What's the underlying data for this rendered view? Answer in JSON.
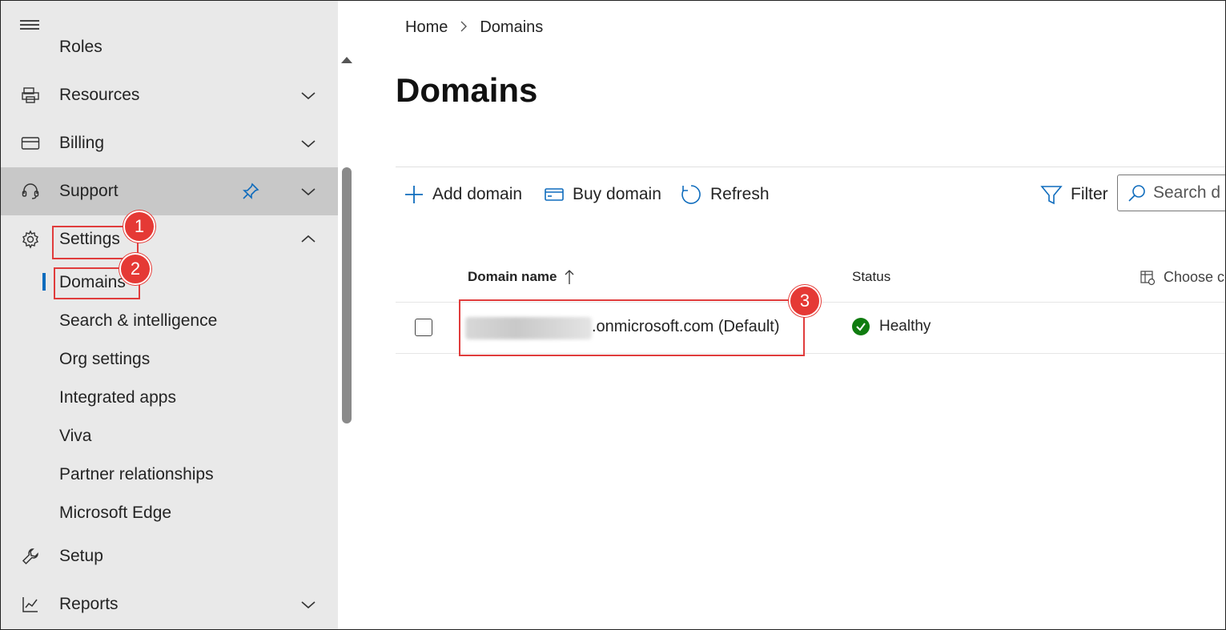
{
  "sidebar": {
    "partial_item": "Roles",
    "items": [
      {
        "label": "Resources",
        "icon": "printer-icon"
      },
      {
        "label": "Billing",
        "icon": "credit-card-icon"
      },
      {
        "label": "Support",
        "icon": "headset-icon"
      },
      {
        "label": "Settings",
        "icon": "gear-icon"
      },
      {
        "label": "Setup",
        "icon": "wrench-icon"
      },
      {
        "label": "Reports",
        "icon": "chart-icon"
      }
    ],
    "settings_sub": [
      "Domains",
      "Search & intelligence",
      "Org settings",
      "Integrated apps",
      "Viva",
      "Partner relationships",
      "Microsoft Edge"
    ]
  },
  "breadcrumb": {
    "home": "Home",
    "current": "Domains"
  },
  "page_title": "Domains",
  "toolbar": {
    "add": "Add domain",
    "buy": "Buy domain",
    "refresh": "Refresh",
    "filter": "Filter",
    "search_placeholder": "Search d"
  },
  "table": {
    "col_domain": "Domain name",
    "col_status": "Status",
    "choose_columns": "Choose co",
    "rows": [
      {
        "domain": ".onmicrosoft.com (Default)",
        "status": "Healthy"
      }
    ]
  },
  "annotations": [
    "1",
    "2",
    "3"
  ],
  "colors": {
    "accent": "#0f6cbd",
    "annotation": "#e53935",
    "healthy": "#107c10"
  }
}
